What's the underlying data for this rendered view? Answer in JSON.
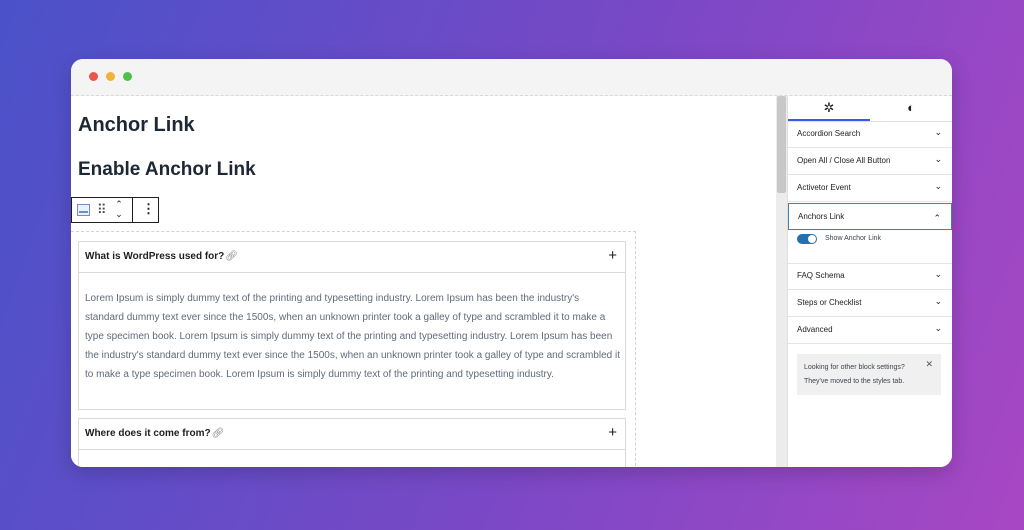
{
  "window": {
    "controls": [
      "close",
      "minimize",
      "maximize"
    ]
  },
  "editor": {
    "heading1": "Anchor Link",
    "heading2": "Enable Anchor Link",
    "toolbar": {
      "block_icon": "block-icon",
      "drag_icon": "drag-handle-icon",
      "more_icon": "more-vertical-icon"
    },
    "accordion": [
      {
        "title": "What is WordPress used for?",
        "body": "Lorem Ipsum is simply dummy text of the printing and typesetting industry. Lorem Ipsum has been the industry's standard dummy text ever since the 1500s, when an unknown printer took a galley of type and scrambled it to make a type specimen book. Lorem Ipsum is simply dummy text of the printing and typesetting industry. Lorem Ipsum has been the industry's standard dummy text ever since the 1500s, when an unknown printer took a galley of type and scrambled it to make a type specimen book. Lorem Ipsum is simply dummy text of the printing and typesetting industry."
      },
      {
        "title": "Where does it come from?"
      }
    ]
  },
  "sidebar": {
    "tabs": [
      {
        "icon": "gear-icon",
        "glyph": "✲"
      },
      {
        "icon": "contrast-icon",
        "glyph": "◐"
      }
    ],
    "panels": [
      {
        "label": "Accordion Search"
      },
      {
        "label": "Open All / Close All Button"
      },
      {
        "label": "Activetor Event"
      },
      {
        "label": "Anchors Link"
      },
      {
        "label": "FAQ Schema"
      },
      {
        "label": "Steps or Checklist"
      },
      {
        "label": "Advanced"
      }
    ],
    "anchor_toggle": {
      "label": "Show Anchor Link",
      "on": true
    },
    "notice": {
      "text": "Looking for other block settings? They've moved to the styles tab."
    }
  },
  "colors": {
    "accent": "#3858e9",
    "toggle": "#2271b1",
    "heading": "#1e2734"
  }
}
